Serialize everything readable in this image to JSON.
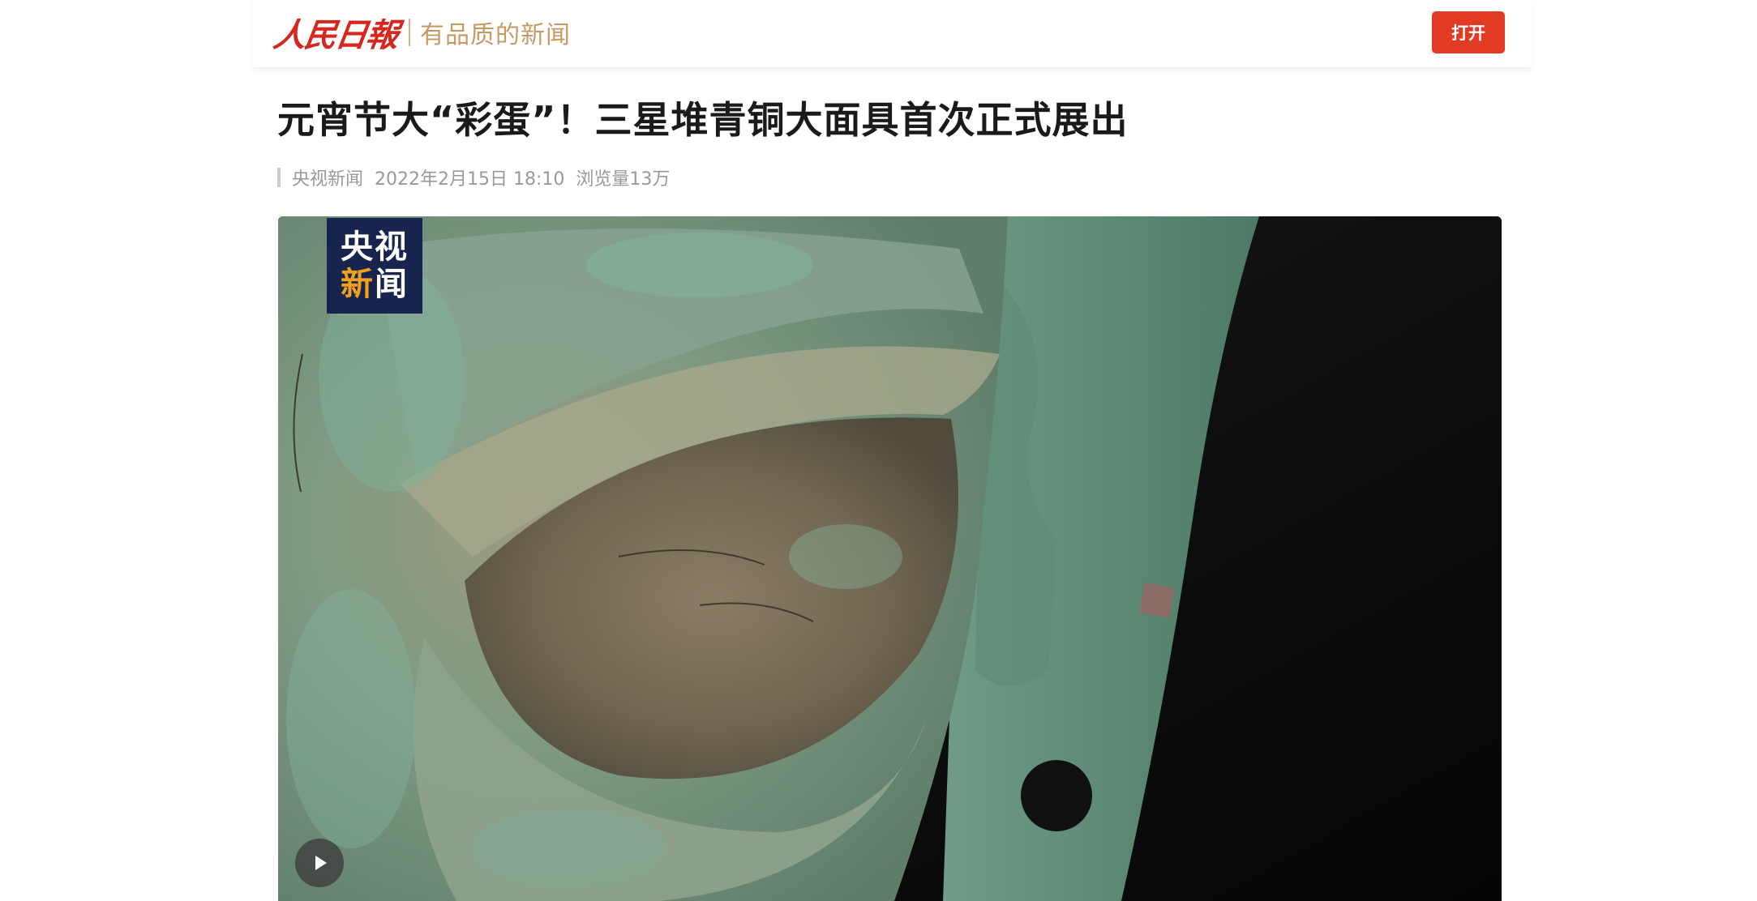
{
  "header": {
    "brand_logo_text": "人民日報",
    "slogan": "有品质的新闻",
    "open_button": "打开",
    "accent_color": "#e23b23"
  },
  "article": {
    "title": "元宵节大“彩蛋”！三星堆青铜大面具首次正式展出",
    "source": "央视新闻",
    "datetime": "2022年2月15日 18:10",
    "views": "浏览量13万"
  },
  "video": {
    "badge_line1": "央视",
    "badge_line2a": "新",
    "badge_line2b": "闻",
    "play_icon": "play-icon",
    "subject": "bronze-mask-closeup"
  }
}
